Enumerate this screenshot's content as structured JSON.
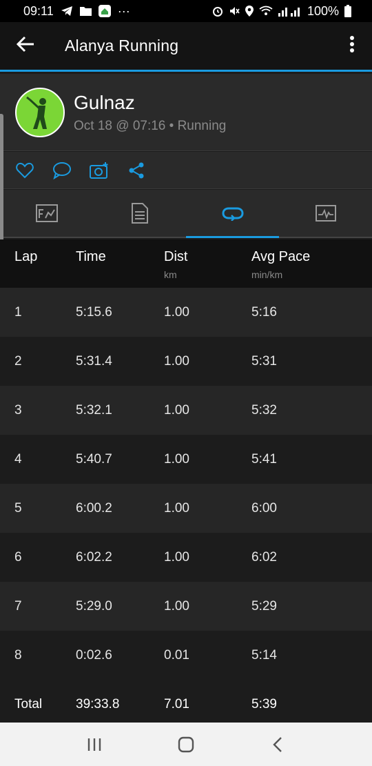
{
  "status_bar": {
    "time": "09:11",
    "more": "···",
    "battery": "100%",
    "icons": [
      "telegram-icon",
      "folder-icon",
      "home-app-icon",
      "alarm-icon",
      "mute-icon",
      "location-icon",
      "wifi-icon",
      "signal-icon",
      "battery-icon"
    ]
  },
  "app_bar": {
    "title": "Alanya Running"
  },
  "header": {
    "name": "Gulnaz",
    "meta": "Oct 18 @ 07:16 • Running"
  },
  "actions": [
    "like",
    "comment",
    "add-photo",
    "share"
  ],
  "tabs": [
    {
      "name": "overview",
      "active": false
    },
    {
      "name": "details",
      "active": false
    },
    {
      "name": "laps",
      "active": true
    },
    {
      "name": "charts",
      "active": false
    }
  ],
  "table": {
    "headers": {
      "lap": "Lap",
      "time": "Time",
      "dist": "Dist",
      "dist_unit": "km",
      "pace": "Avg Pace",
      "pace_unit": "min/km"
    },
    "rows": [
      {
        "lap": "1",
        "time": "5:15.6",
        "dist": "1.00",
        "pace": "5:16"
      },
      {
        "lap": "2",
        "time": "5:31.4",
        "dist": "1.00",
        "pace": "5:31"
      },
      {
        "lap": "3",
        "time": "5:32.1",
        "dist": "1.00",
        "pace": "5:32"
      },
      {
        "lap": "4",
        "time": "5:40.7",
        "dist": "1.00",
        "pace": "5:41"
      },
      {
        "lap": "5",
        "time": "6:00.2",
        "dist": "1.00",
        "pace": "6:00"
      },
      {
        "lap": "6",
        "time": "6:02.2",
        "dist": "1.00",
        "pace": "6:02"
      },
      {
        "lap": "7",
        "time": "5:29.0",
        "dist": "1.00",
        "pace": "5:29"
      },
      {
        "lap": "8",
        "time": "0:02.6",
        "dist": "0.01",
        "pace": "5:14"
      }
    ],
    "total": {
      "lap": "Total",
      "time": "39:33.8",
      "dist": "7.01",
      "pace": "5:39"
    }
  },
  "colors": {
    "accent": "#1a9be0",
    "avatar_bg": "#7bd636"
  }
}
